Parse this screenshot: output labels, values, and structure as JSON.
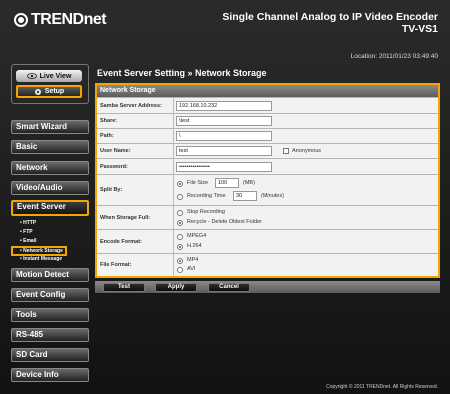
{
  "header": {
    "brand": "TRENDnet",
    "product_line1": "Single Channel Analog to IP Video Encoder",
    "product_line2": "TV-VS1",
    "location_label": "Location:",
    "datetime": "2011/01/23 03:49:40"
  },
  "sidebar": {
    "live_view": "Live View",
    "setup": "Setup",
    "nav": [
      "Smart Wizard",
      "Basic",
      "Network",
      "Video/Audio",
      "Event Server",
      "Motion Detect",
      "Event Config",
      "Tools",
      "RS-485",
      "SD Card",
      "Device Info"
    ],
    "sub": [
      "• HTTP",
      "• FTP",
      "• Email",
      "• Network Storage",
      "• Instant Message"
    ]
  },
  "main": {
    "title": "Event Server Setting » Network Storage",
    "section_title": "Network Storage",
    "labels": {
      "samba": "Samba Server Address:",
      "share": "Share:",
      "path": "Path:",
      "user": "User Name:",
      "password": "Password:",
      "split": "Split By:",
      "full": "When Storage Full:",
      "encode": "Encode Format:",
      "file": "File Format:"
    },
    "values": {
      "samba": "192.168.10.232",
      "share": "\\test",
      "path": "\\",
      "user": "test",
      "password": "••••••••••••••••",
      "file_size": "100",
      "recording_time": "30"
    },
    "anonymous": "Anonymous",
    "split_opts": {
      "file_size": "File Size",
      "file_size_unit": "(MB)",
      "recording_time": "Recording Time",
      "recording_time_unit": "(Minutes)"
    },
    "full_opts": [
      "Stop Recording",
      "Recycle - Delete Oldest Folder"
    ],
    "encode_opts": [
      "MPEG4",
      "H.264"
    ],
    "file_opts": [
      "MP4",
      "AVI"
    ],
    "buttons": {
      "test": "Test",
      "apply": "Apply",
      "cancel": "Cancel"
    }
  },
  "footer": "Copyright © 2011 TRENDnet. All Rights Reserved.",
  "colors": {
    "accent": "#f7a400"
  }
}
